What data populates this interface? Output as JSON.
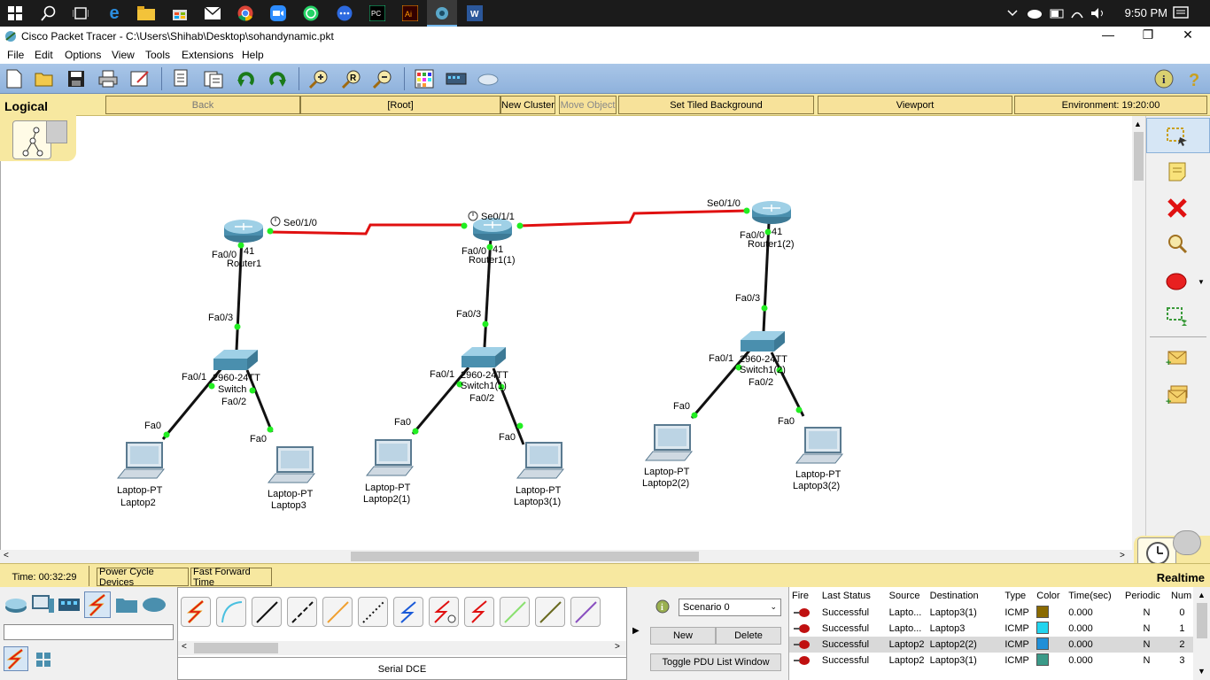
{
  "taskbar": {
    "time": "9:50 PM"
  },
  "window": {
    "title": "Cisco Packet Tracer - C:\\Users\\Shihab\\Desktop\\sohandynamic.pkt",
    "minimize": "—",
    "maximize": "❐",
    "close": "✕"
  },
  "menu": [
    "File",
    "Edit",
    "Options",
    "View",
    "Tools",
    "Extensions",
    "Help"
  ],
  "logical_bar": {
    "mode": "Logical",
    "back": "Back",
    "root": "[Root]",
    "new_cluster": "New Cluster",
    "move_object": "Move Object",
    "set_tiled_background": "Set Tiled Background",
    "viewport": "Viewport",
    "environment": "Environment: 19:20:00"
  },
  "topology": {
    "routers": [
      {
        "model": "41",
        "name": "Router1",
        "fa": "Fa0/0",
        "serial": "Se0/1/0"
      },
      {
        "model": "41",
        "name": "Router1(1)",
        "fa": "Fa0/0",
        "serial": "Se0/1/1"
      },
      {
        "model": "41",
        "name": "Router1(2)",
        "fa": "Fa0/0",
        "serial": "Se0/1/0"
      }
    ],
    "switches": [
      {
        "model": "2960-24TT",
        "name": "Switch",
        "up": "Fa0/3",
        "p1": "Fa0/1",
        "p2": "Fa0/2"
      },
      {
        "model": "2960-24TT",
        "name": "Switch1(1)",
        "up": "Fa0/3",
        "p1": "Fa0/1",
        "p2": "Fa0/2"
      },
      {
        "model": "2960-24TT",
        "name": "Switch1(2)",
        "up": "Fa0/3",
        "p1": "Fa0/1",
        "p2": "Fa0/2"
      }
    ],
    "laptops": [
      {
        "model": "Laptop-PT",
        "name": "Laptop2",
        "port": "Fa0"
      },
      {
        "model": "Laptop-PT",
        "name": "Laptop3",
        "port": "Fa0"
      },
      {
        "model": "Laptop-PT",
        "name": "Laptop2(1)",
        "port": "Fa0"
      },
      {
        "model": "Laptop-PT",
        "name": "Laptop3(1)",
        "port": "Fa0"
      },
      {
        "model": "Laptop-PT",
        "name": "Laptop2(2)",
        "port": "Fa0"
      },
      {
        "model": "Laptop-PT",
        "name": "Laptop3(2)",
        "port": "Fa0"
      }
    ]
  },
  "status_bar": {
    "time": "Time: 00:32:29",
    "power_cycle": "Power Cycle Devices",
    "fast_forward": "Fast Forward Time",
    "mode": "Realtime"
  },
  "connections": {
    "selected_label": "Serial DCE",
    "search_value": ""
  },
  "scenario": {
    "selected": "Scenario 0",
    "new": "New",
    "delete": "Delete",
    "toggle": "Toggle PDU List Window"
  },
  "pdu_table": {
    "headers": [
      "Fire",
      "Last Status",
      "Source",
      "Destination",
      "Type",
      "Color",
      "Time(sec)",
      "Periodic",
      "Num"
    ],
    "rows": [
      {
        "status": "Successful",
        "source": "Lapto...",
        "destination": "Laptop3(1)",
        "type": "ICMP",
        "color": "#8a6a00",
        "time": "0.000",
        "periodic": "N",
        "num": "0"
      },
      {
        "status": "Successful",
        "source": "Lapto...",
        "destination": "Laptop3",
        "type": "ICMP",
        "color": "#22d4ee",
        "time": "0.000",
        "periodic": "N",
        "num": "1"
      },
      {
        "status": "Successful",
        "source": "Laptop2",
        "destination": "Laptop2(2)",
        "type": "ICMP",
        "color": "#1f8fd8",
        "time": "0.000",
        "periodic": "N",
        "num": "2"
      },
      {
        "status": "Successful",
        "source": "Laptop2",
        "destination": "Laptop3(1)",
        "type": "ICMP",
        "color": "#3a9a88",
        "time": "0.000",
        "periodic": "N",
        "num": "3"
      }
    ]
  },
  "colors": {
    "serial_link": "#e01010",
    "link_up": "#22ee22",
    "router": "#5f9fba",
    "palette_yellow": "#f7e8a0",
    "toolbar_blue": "#9ebde3"
  }
}
